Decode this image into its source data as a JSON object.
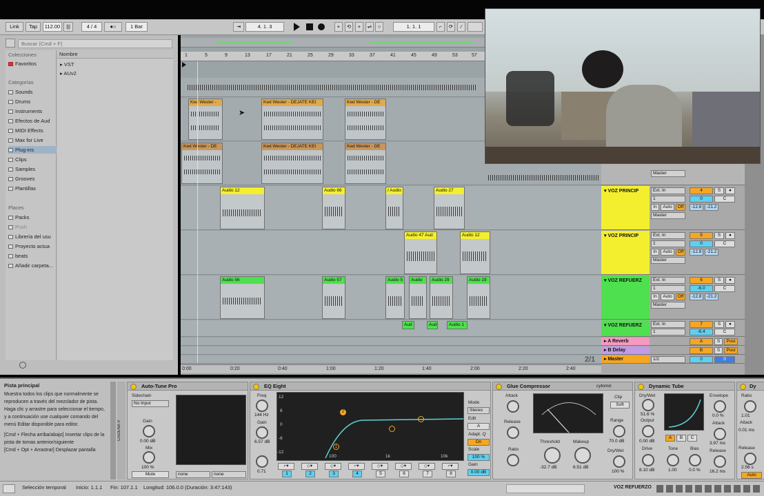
{
  "transport": {
    "link": "Link",
    "tap": "Tap",
    "tempo": "112.00",
    "signature": "4 / 4",
    "quantize": "1 Bar",
    "position": "4. 1. 3",
    "loop_start": "1. 1. 1"
  },
  "browser": {
    "search_placeholder": "Buscar (Cmd + F)",
    "collections_title": "Colecciones",
    "favorites": "Favoritos",
    "categories_title": "Categorías",
    "categories": [
      "Sounds",
      "Drums",
      "Instruments",
      "Efectos de Aud",
      "MIDI Effects",
      "Max for Live",
      "Plug-ins",
      "Clips",
      "Samples",
      "Grooves",
      "Plantillas"
    ],
    "places_title": "Places",
    "places": [
      "Packs",
      "Push",
      "Librería del usu",
      "Proyecto actua",
      "beats",
      "Añadir carpeta..."
    ],
    "column_name": "Nombre",
    "items": [
      "VST",
      "AUv2"
    ]
  },
  "ruler": {
    "bars": [
      "1",
      "5",
      "9",
      "13",
      "17",
      "21",
      "25",
      "29",
      "33",
      "37",
      "41",
      "45",
      "49",
      "53",
      "57"
    ],
    "times": [
      "0:00",
      "0:20",
      "0:40",
      "1:00",
      "1:20",
      "1:40",
      "2:00",
      "2:20",
      "2:40"
    ],
    "page": "2/1"
  },
  "clips": {
    "kw1": "Ked Wester -",
    "kw2": "Ked Wester - DEJATE KEI",
    "kw3": "Ked Wester - DE",
    "kw4": "Ked Wester - DE",
    "kw5": "Ked Wester - DEJATE KEI",
    "kw6": "Ked Wester - DE",
    "a12": "Audio 12",
    "a66": "Audio 66",
    "aslash": "/ Audio",
    "a27": "Audio 27",
    "a47": "Audio 47 Aud",
    "a12b": "Audio 12",
    "a56": "Audio 56",
    "a57": "Audio 57",
    "a5": "Audio 5",
    "aud1": "Audio",
    "a29": "Audio 29",
    "a19": "Audio 19",
    "aud": "Aud",
    "aud2": "Aud",
    "a1": "Audio 1"
  },
  "mixer": {
    "tracks": [
      {
        "name": "VOZ PRINCIP",
        "input": "Ext. In",
        "ch": "1",
        "num": "4",
        "vol": "0",
        "pan": "C",
        "l": "-12.8",
        "r": "-21.2",
        "out": "Master"
      },
      {
        "name": "VOZ PRINCIP",
        "input": "Ext. In",
        "ch": "1",
        "num": "5",
        "vol": "0",
        "pan": "C",
        "l": "-12.8",
        "r": "-21.2",
        "out": "Master"
      },
      {
        "name": "VOZ REFUERZ",
        "input": "Ext. In",
        "ch": "1",
        "num": "6",
        "vol": "-6.0",
        "pan": "C",
        "l": "-12.8",
        "r": "-21.2",
        "out": "Master"
      },
      {
        "name": "VOZ REFUERZ",
        "input": "Ext. In",
        "ch": "1",
        "num": "7",
        "vol": "-6.4",
        "pan": "C",
        "l": "",
        "r": "",
        "out": ""
      }
    ],
    "in_label": "In",
    "auto_label": "Auto",
    "off_label": "Off",
    "s_label": "S",
    "top_out": "Master",
    "returns": [
      {
        "name": "A Reverb",
        "num": "A",
        "post": "Post"
      },
      {
        "name": "B Delay",
        "num": "B",
        "post": "Post"
      }
    ],
    "master": {
      "name": "Master",
      "out": "1/2",
      "vol": "0",
      "pan": "0"
    }
  },
  "info": {
    "title": "Pista principal",
    "body": "Muestra todos los clips que normalmente se reproducen a través del mezclador de pista. Haga clic y arrastre para seleccionar el tiempo, y a continuación use cualquier comando del menú Editar disponible para editor.",
    "hint1": "[Cmd + Flecha arriba/abajo] Insertar clips de la pista de tomas anterior/siguiente",
    "hint2": "[Cmd + Opt + Arrastrar] Desplazar pantalla"
  },
  "devices": {
    "autotune": {
      "title": "Auto-Tune Pro",
      "sidechain": "Sidechain",
      "input": "No Input",
      "gain": "Gain",
      "gain_val": "0.00 dB",
      "mix": "Mix",
      "mix_val": "100 %",
      "mute": "Mute",
      "none1": "none",
      "none2": "none",
      "chain": "CADENA V"
    },
    "eq": {
      "title": "EQ Eight",
      "freq": "Freq",
      "freq_val": "144 Hz",
      "gain": "Gain",
      "gain_val": "6.57 dB",
      "q_val": "0.71",
      "mode": "Mode",
      "stereo": "Stereo",
      "edit": "Edit",
      "a": "A",
      "adapt": "Adapt. Q",
      "on": "On",
      "scale": "Scale",
      "scale_val": "100 %",
      "gain2": "Gain",
      "gain2_val": "0.00 dB",
      "y": [
        "12",
        "6",
        "0",
        "-6",
        "-12"
      ],
      "x": [
        "100",
        "1k",
        "10k"
      ],
      "bands": [
        "1",
        "2",
        "3",
        "4",
        "5",
        "6",
        "7",
        "8"
      ]
    },
    "glue": {
      "title": "Glue Compressor",
      "brand": "cytomic",
      "attack": "Attack",
      "release": "Release",
      "ratio": "Ratio",
      "threshold": "Threshold",
      "thr_val": "-32.7 dB",
      "makeup": "Makeup",
      "mk_val": "6.51 dB",
      "clip": "Clip",
      "soft": "Soft",
      "range": "Range",
      "range_val": "70.0 dB",
      "drywet": "Dry/Wet",
      "dw_val": "100 %"
    },
    "tube": {
      "title": "Dynamic Tube",
      "drywet": "Dry/Wet",
      "dw_val": "51.6 %",
      "output": "Output",
      "out_val": "0.00 dB",
      "drive": "Drive",
      "drive_val": "8.10 dB",
      "tone": "Tone",
      "tone_val": "1.00",
      "bias": "Bias",
      "bias_val": "0.0 %",
      "envelope": "Envelope",
      "env_val": "0.0 %",
      "attack": "Attack",
      "att_val": "3.97 ms",
      "release": "Release",
      "rel_val": "16.2 ms",
      "abc": [
        "A",
        "B",
        "C"
      ]
    },
    "next": {
      "title": "Dy",
      "ratio": "Ratio",
      "r_val": "1.01",
      "attack": "Attack",
      "a_val": "0.01 ms",
      "release": "Release",
      "rel_val": "2.56 s",
      "auto": "Auto"
    }
  },
  "status": {
    "selection": "Selección temporal",
    "start": "Inicio: 1.1.1",
    "end": "Fin: 107.1.1",
    "length": "Longitud: 106.0.0 (Duración: 3:47:143)",
    "track": "VOZ REFUERZO"
  }
}
